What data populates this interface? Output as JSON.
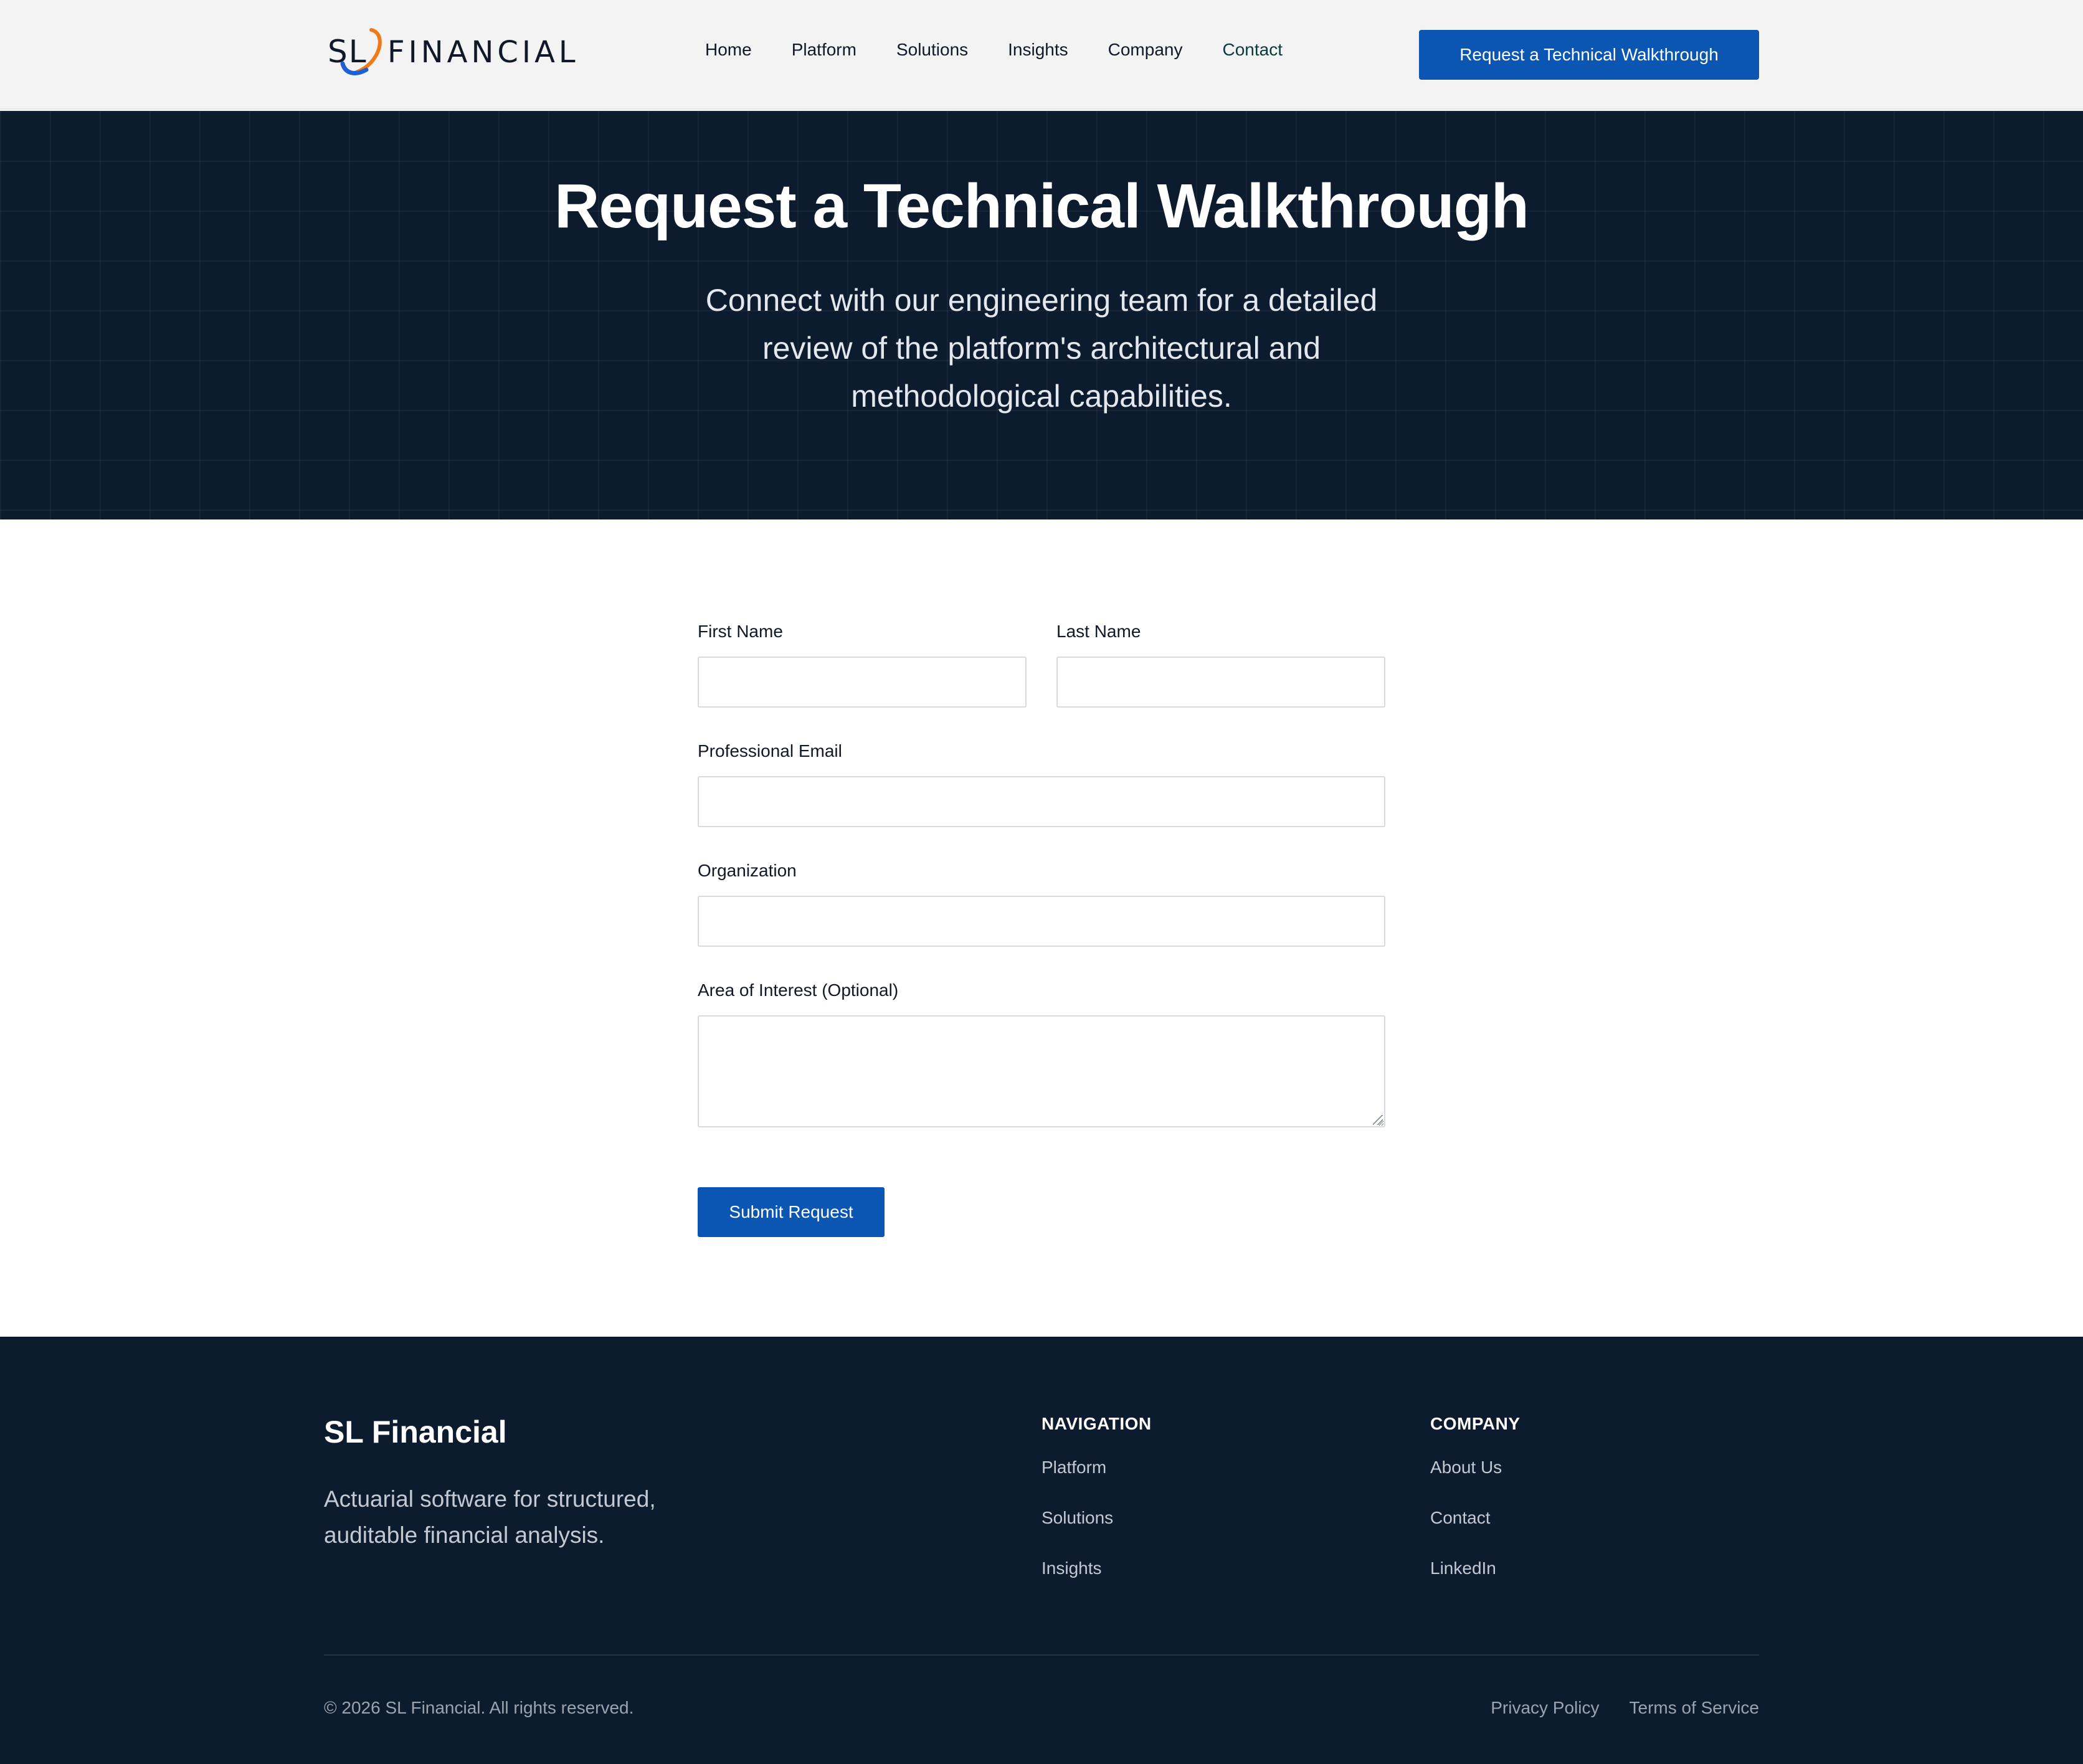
{
  "header": {
    "logo_text": "SL",
    "logo_wordmark": "FINANCIAL",
    "nav": [
      {
        "label": "Home"
      },
      {
        "label": "Platform"
      },
      {
        "label": "Solutions"
      },
      {
        "label": "Insights"
      },
      {
        "label": "Company"
      },
      {
        "label": "Contact"
      }
    ],
    "cta_label": "Request a Technical Walkthrough"
  },
  "hero": {
    "title": "Request a Technical Walkthrough",
    "subtitle": "Connect with our engineering team for a detailed review of the platform's architectural and methodological capabilities."
  },
  "form": {
    "first_name": {
      "label": "First Name",
      "value": ""
    },
    "last_name": {
      "label": "Last Name",
      "value": ""
    },
    "email": {
      "label": "Professional Email",
      "value": ""
    },
    "organization": {
      "label": "Organization",
      "value": ""
    },
    "interest": {
      "label": "Area of Interest (Optional)",
      "value": ""
    },
    "submit_label": "Submit Request"
  },
  "footer": {
    "brand": "SL Financial",
    "tagline": "Actuarial software for structured, auditable financial analysis.",
    "navigation": {
      "heading": "NAVIGATION",
      "links": [
        "Platform",
        "Solutions",
        "Insights"
      ]
    },
    "company": {
      "heading": "COMPANY",
      "links": [
        "About Us",
        "Contact",
        "LinkedIn"
      ]
    },
    "copyright": "© 2026 SL Financial. All rights reserved.",
    "legal": [
      "Privacy Policy",
      "Terms of Service"
    ]
  },
  "colors": {
    "primary": "#0b55b3",
    "dark_navy": "#0d1b2e",
    "header_bg": "#f3f3f3",
    "logo_orange": "#f07a1a",
    "logo_blue": "#1f5fd6"
  }
}
